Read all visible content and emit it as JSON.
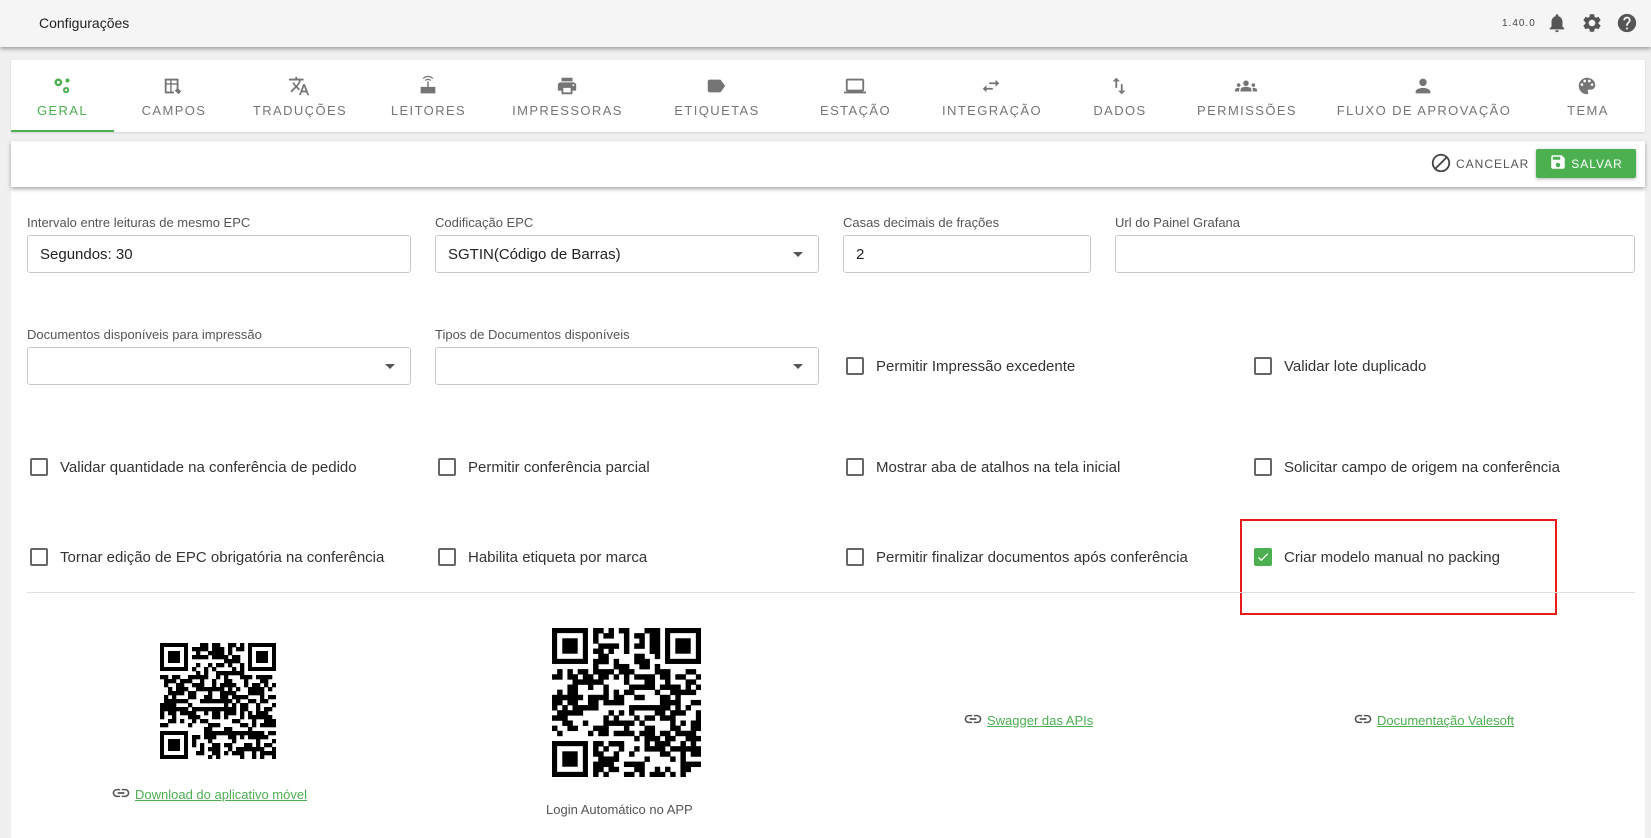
{
  "app": {
    "title": "Configurações",
    "version": "1.40.0"
  },
  "topbar_icons": {
    "notifications": "bell-icon",
    "settings": "gear-icon",
    "help": "help-icon"
  },
  "tabs": [
    {
      "label": "GERAL",
      "icon": "gears-icon",
      "active": true
    },
    {
      "label": "CAMPOS",
      "icon": "table-edit-icon"
    },
    {
      "label": "TRADUÇÕES",
      "icon": "translate-icon"
    },
    {
      "label": "LEITORES",
      "icon": "router-icon"
    },
    {
      "label": "IMPRESSORAS",
      "icon": "printer-icon"
    },
    {
      "label": "ETIQUETAS",
      "icon": "label-icon"
    },
    {
      "label": "ESTAÇÃO",
      "icon": "laptop-icon"
    },
    {
      "label": "INTEGRAÇÃO",
      "icon": "swap-arrows-icon"
    },
    {
      "label": "DADOS",
      "icon": "sort-arrows-icon"
    },
    {
      "label": "PERMISSÕES",
      "icon": "group-icon"
    },
    {
      "label": "FLUXO DE APROVAÇÃO",
      "icon": "person-icon"
    },
    {
      "label": "TEMA",
      "icon": "palette-icon"
    }
  ],
  "actions": {
    "cancel_label": "CANCELAR",
    "save_label": "SALVAR"
  },
  "fields": {
    "interval": {
      "label": "Intervalo entre leituras de mesmo EPC",
      "value": "Segundos: 30"
    },
    "encoding": {
      "label": "Codificação EPC",
      "value": "SGTIN(Código de Barras)"
    },
    "decimals": {
      "label": "Casas decimais de frações",
      "value": "2"
    },
    "grafana": {
      "label": "Url do Painel Grafana",
      "value": ""
    },
    "print_docs": {
      "label": "Documentos disponíveis para impressão",
      "value": ""
    },
    "doc_types": {
      "label": "Tipos de Documentos disponíveis",
      "value": ""
    }
  },
  "checkboxes": {
    "permitir_impressao_excedente": {
      "label": "Permitir Impressão excedente",
      "checked": false
    },
    "validar_lote_duplicado": {
      "label": "Validar lote duplicado",
      "checked": false
    },
    "validar_quantidade": {
      "label": "Validar quantidade na conferência de pedido",
      "checked": false
    },
    "permitir_conferencia_parcial": {
      "label": "Permitir conferência parcial",
      "checked": false
    },
    "mostrar_aba_atalhos": {
      "label": "Mostrar aba de atalhos na tela inicial",
      "checked": false
    },
    "solicitar_campo_origem": {
      "label": "Solicitar campo de origem na conferência",
      "checked": false
    },
    "tornar_edicao_epc": {
      "label": "Tornar edição de EPC obrigatória na conferência",
      "checked": false
    },
    "habilita_etiqueta_marca": {
      "label": "Habilita etiqueta por marca",
      "checked": false
    },
    "permitir_finalizar_docs": {
      "label": "Permitir finalizar documentos após conferência",
      "checked": false
    },
    "criar_modelo_manual": {
      "label": "Criar modelo manual no packing",
      "checked": true
    }
  },
  "links": {
    "download_app": "Download do aplicativo móvel",
    "swagger": "Swagger das APIs",
    "docs": "Documentação Valesoft"
  },
  "captions": {
    "login_app": "Login Automático no APP"
  },
  "colors": {
    "accent": "#4caf50",
    "highlight": "#e81c1c"
  }
}
